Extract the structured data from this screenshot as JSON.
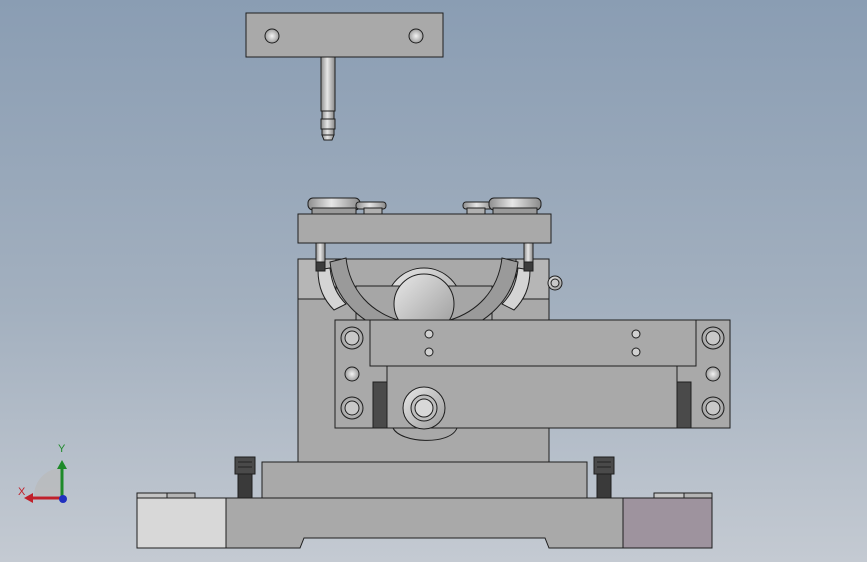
{
  "viewport": {
    "background_top": "#8a9db3",
    "background_bottom": "#c4cad2"
  },
  "model": {
    "part_color": "#a9a9a9",
    "edge_color": "#1e1e1e",
    "left_insert_color": "#d8d8d8",
    "right_insert_color": "#9e939e"
  },
  "triad": {
    "x_label": "X",
    "y_label": "Y",
    "x_color": "#c0202a",
    "y_color": "#1e8a2a",
    "z_color": "#2030c0"
  }
}
